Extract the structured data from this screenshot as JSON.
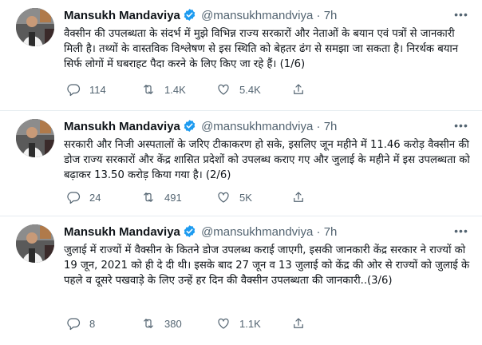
{
  "tweets": [
    {
      "name": "Mansukh Mandaviya",
      "handle": "@mansukhmandviya",
      "dot": "·",
      "time": "7h",
      "text": "वैक्सीन की उपलब्धता के संदर्भ में मुझे विभिन्न राज्य सरकारों और नेताओं के बयान एवं पत्रों से जानकारी मिली है। तथ्यों के वास्तविक विश्लेषण से इस स्थिति को बेहतर ढंग से समझा जा सकता है। निरर्थक बयान सिर्फ लोगों में घबराहट पैदा करने के लिए किए जा रहे हैं। (1/6)",
      "replies": "114",
      "retweets": "1.4K",
      "likes": "5.4K"
    },
    {
      "name": "Mansukh Mandaviya",
      "handle": "@mansukhmandviya",
      "dot": "·",
      "time": "7h",
      "text": "सरकारी और निजी अस्पतालों के जरिए टीकाकरण हो सके, इसलिए जून महीने में 11.46 करोड़ वैक्सीन की डोज राज्य सरकारों और केंद्र शासित प्रदेशों को उपलब्ध कराए गए और जुलाई के महीने में इस उपलब्धता को बढ़ाकर 13.50 करोड़ किया गया है। (2/6)",
      "replies": "24",
      "retweets": "491",
      "likes": "5K"
    },
    {
      "name": "Mansukh Mandaviya",
      "handle": "@mansukhmandviya",
      "dot": "·",
      "time": "7h",
      "text": "जुलाई में राज्यों में वैक्सीन के कितने डोज उपलब्ध कराई जाएगी, इसकी जानकारी केंद्र सरकार ने राज्यों को 19 जून, 2021 को ही दे दी थी। इसके बाद 27 जून व 13 जुलाई को केंद्र की ओर से राज्यों को जुलाई के पहले व दूसरे पखवाड़े के लिए उन्हें हर दिन की वैक्सीन उपलब्धता की जानकारी..(3/6)",
      "replies": "8",
      "retweets": "380",
      "likes": "1.1K"
    }
  ],
  "icons": {
    "verified": "verified-badge-icon",
    "more": "more-icon",
    "reply": "reply-icon",
    "retweet": "retweet-icon",
    "like": "like-icon",
    "share": "share-icon"
  },
  "colors": {
    "verified": "#1d9bf0",
    "secondary_text": "#536471",
    "divider": "#e6ecf0"
  }
}
